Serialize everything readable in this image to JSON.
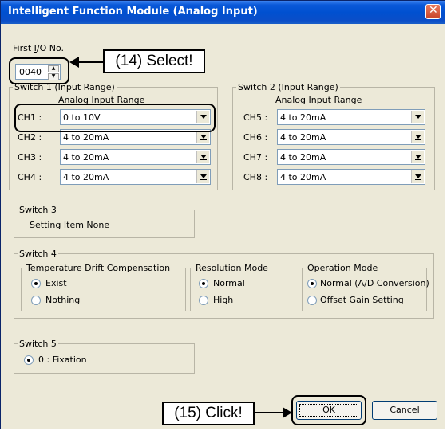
{
  "window": {
    "title": "Intelligent Function Module (Analog Input)"
  },
  "first_io": {
    "label": "First I/O No.",
    "value": "0040"
  },
  "switch1": {
    "title": "Switch 1 (Input Range)",
    "header": "Analog Input Range",
    "channels": [
      {
        "label": "CH1 :",
        "value": "0 to 10V"
      },
      {
        "label": "CH2 :",
        "value": "4 to 20mA"
      },
      {
        "label": "CH3 :",
        "value": "4 to 20mA"
      },
      {
        "label": "CH4 :",
        "value": "4 to 20mA"
      }
    ]
  },
  "switch2": {
    "title": "Switch 2 (Input Range)",
    "header": "Analog Input Range",
    "channels": [
      {
        "label": "CH5 :",
        "value": "4 to 20mA"
      },
      {
        "label": "CH6 :",
        "value": "4 to 20mA"
      },
      {
        "label": "CH7 :",
        "value": "4 to 20mA"
      },
      {
        "label": "CH8 :",
        "value": "4 to 20mA"
      }
    ]
  },
  "switch3": {
    "title": "Switch 3",
    "text": "Setting Item None"
  },
  "switch4": {
    "title": "Switch 4",
    "temp": {
      "title": "Temperature Drift Compensation",
      "options": [
        "Exist",
        "Nothing"
      ],
      "selected": 0
    },
    "resolution": {
      "title": "Resolution Mode",
      "options": [
        "Normal",
        "High"
      ],
      "selected": 0
    },
    "operation": {
      "title": "Operation Mode",
      "options": [
        "Normal (A/D Conversion)",
        "Offset Gain Setting"
      ],
      "selected": 0
    }
  },
  "switch5": {
    "title": "Switch 5",
    "option": "0 : Fixation"
  },
  "buttons": {
    "ok": "OK",
    "cancel": "Cancel"
  },
  "annotations": {
    "select": "(14) Select!",
    "click": "(15) Click!"
  }
}
